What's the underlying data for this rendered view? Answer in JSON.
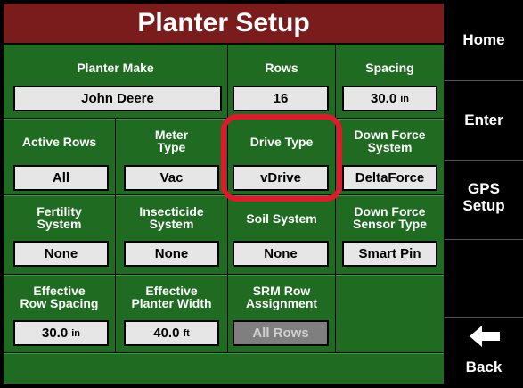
{
  "title": "Planter Setup",
  "fields": {
    "planter_make": {
      "label": "Planter Make",
      "value": "John Deere"
    },
    "rows": {
      "label": "Rows",
      "value": "16"
    },
    "spacing": {
      "label": "Spacing",
      "value": "30.0",
      "unit": "in"
    },
    "active_rows": {
      "label": "Active Rows",
      "value": "All"
    },
    "meter_type": {
      "label": "Meter\nType",
      "value": "Vac"
    },
    "drive_type": {
      "label": "Drive Type",
      "value": "vDrive"
    },
    "down_force_system": {
      "label": "Down Force\nSystem",
      "value": "DeltaForce"
    },
    "fertility_system": {
      "label": "Fertility\nSystem",
      "value": "None"
    },
    "insecticide_system": {
      "label": "Insecticide\nSystem",
      "value": "None"
    },
    "soil_system": {
      "label": "Soil System",
      "value": "None"
    },
    "down_force_sensor_type": {
      "label": "Down Force\nSensor Type",
      "value": "Smart Pin"
    },
    "effective_row_spacing": {
      "label": "Effective\nRow Spacing",
      "value": "30.0",
      "unit": "in"
    },
    "effective_planter_width": {
      "label": "Effective\nPlanter Width",
      "value": "40.0",
      "unit": "ft"
    },
    "srm_row_assignment": {
      "label": "SRM Row\nAssignment",
      "value": "All Rows"
    }
  },
  "sidebar": {
    "home": "Home",
    "enter": "Enter",
    "gps_setup": "GPS\nSetup",
    "back": "Back"
  },
  "colors": {
    "title_bg": "#7a1c1c",
    "cell_bg": "#1f6b21",
    "highlight": "#e01a2a"
  }
}
